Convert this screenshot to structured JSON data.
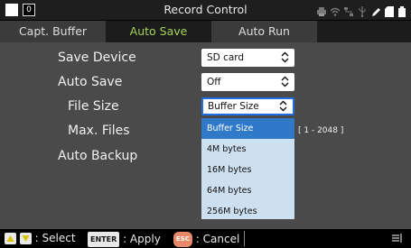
{
  "window": {
    "title": "Record Control",
    "channel_badge": "0"
  },
  "status_icons": [
    "print-icon",
    "wifi-icon",
    "network-icon",
    "usb-icon",
    "pen-icon",
    "sd-card-icon",
    "battery-icon"
  ],
  "tabs": [
    {
      "label": "Capt. Buffer",
      "active": false
    },
    {
      "label": "Auto Save",
      "active": true
    },
    {
      "label": "Auto Run",
      "active": false
    }
  ],
  "settings": {
    "save_device": {
      "label": "Save Device",
      "value": "SD card"
    },
    "auto_save": {
      "label": "Auto Save",
      "value": "Off"
    },
    "file_size": {
      "label": "File Size",
      "value": "Buffer Size"
    },
    "max_files": {
      "label": "Max. Files",
      "range": "[ 1 - 2048 ]"
    },
    "auto_backup": {
      "label": "Auto Backup"
    }
  },
  "dropdown": {
    "options": [
      "Buffer Size",
      "4M bytes",
      "16M bytes",
      "64M bytes",
      "256M bytes"
    ],
    "selected_index": 0
  },
  "bottom": {
    "select_label": ": Select",
    "enter_key": "ENTER",
    "apply_label": ": Apply",
    "esc_key": "ESC",
    "cancel_label": ": Cancel"
  },
  "colors": {
    "active_tab_text": "#a6d35a",
    "focus_border": "#1e6fe0",
    "dropdown_selected": "#2f79c8",
    "dropdown_bg": "#cde0f0",
    "esc_key": "#e88a6a"
  }
}
